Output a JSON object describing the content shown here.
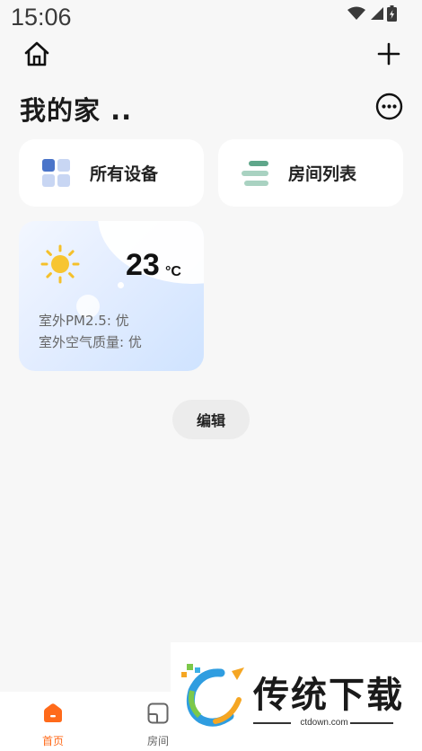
{
  "status": {
    "time": "15:06"
  },
  "header": {
    "title": "我的家 .."
  },
  "cards": [
    {
      "label": "所有设备"
    },
    {
      "label": "房间列表"
    }
  ],
  "weather": {
    "temperature": "23",
    "unit": "°C",
    "pm25": "室外PM2.5: 优",
    "air_quality": "室外空气质量: 优"
  },
  "edit_label": "编辑",
  "tabs": [
    {
      "label": "首页",
      "active": true
    },
    {
      "label": "房间",
      "active": false
    }
  ],
  "watermark": {
    "title": "传统下载",
    "subtitle": "ctdown.com"
  },
  "colors": {
    "accent": "#ff6a1a",
    "tab_inactive": "#666666"
  }
}
